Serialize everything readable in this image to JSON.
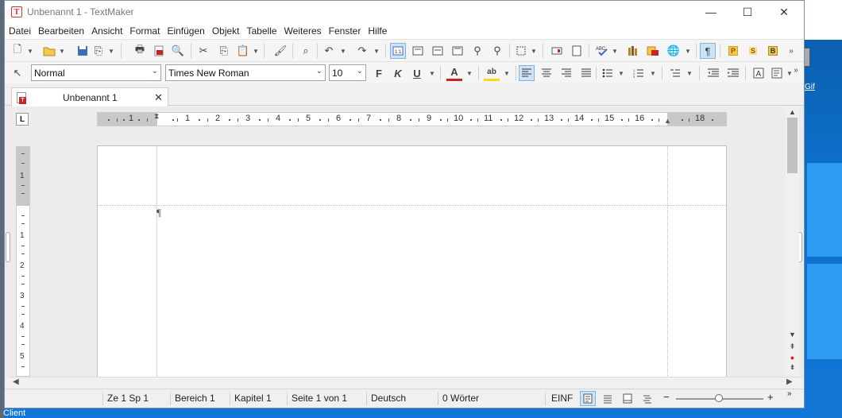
{
  "window": {
    "title": "Unbenannt 1 - TextMaker",
    "app_icon": "T",
    "minimize": "—",
    "maximize": "☐",
    "close": "✕"
  },
  "menu": [
    "Datei",
    "Bearbeiten",
    "Ansicht",
    "Format",
    "Einfügen",
    "Objekt",
    "Tabelle",
    "Weiteres",
    "Fenster",
    "Hilfe"
  ],
  "format_bar": {
    "style": "Normal",
    "font": "Times New Roman",
    "size": "10",
    "bold": "F",
    "italic": "K",
    "underline": "U",
    "font_color": "A",
    "highlight": "ab"
  },
  "toolbar_letters": {
    "p": "P",
    "s": "S",
    "b": "B"
  },
  "tab": {
    "label": "Unbenannt 1",
    "close": "✕"
  },
  "ruler": {
    "numbers": [
      "1",
      "1",
      "2",
      "3",
      "4",
      "5",
      "6",
      "7",
      "8",
      "9",
      "10",
      "11",
      "12",
      "13",
      "14",
      "15",
      "16",
      "18"
    ],
    "tab_marker": "L",
    "vertical_numbers": [
      "1",
      "1",
      "2",
      "3",
      "4",
      "5"
    ]
  },
  "document": {
    "paragraph_mark": "¶"
  },
  "statusbar": {
    "position": "Ze 1 Sp 1",
    "section": "Bereich 1",
    "chapter": "Kapitel 1",
    "page": "Seite 1 von 1",
    "language": "Deutsch",
    "words": "0 Wörter",
    "mode": "EINF",
    "zoom_minus": "−",
    "zoom_plus": "+"
  },
  "desktop": {
    "gif_label": "Gif",
    "client_label": "Client"
  }
}
